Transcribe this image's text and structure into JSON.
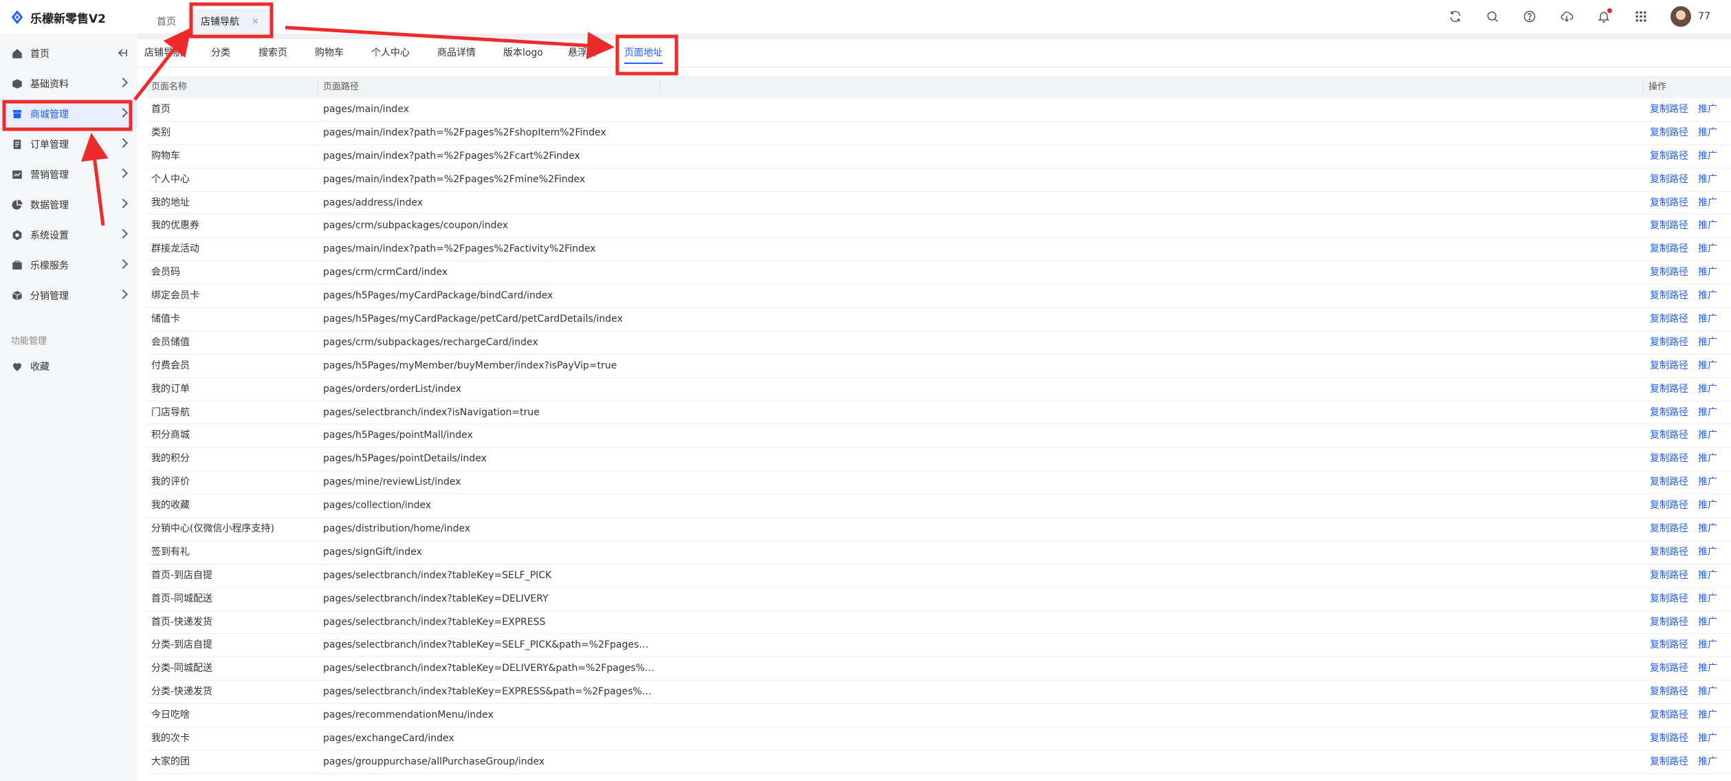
{
  "app": {
    "title": "乐檬新零售V2"
  },
  "top_tabs": [
    {
      "label": "首页"
    },
    {
      "label": "店铺导航",
      "close": "×"
    }
  ],
  "user": {
    "name": "77"
  },
  "icons": [
    "refresh-icon",
    "search-icon",
    "help-icon",
    "cloud-download-icon",
    "bell-icon",
    "apps-grid-icon"
  ],
  "colors": {
    "accent": "#1f5eff",
    "annotation": "#ee2b2b",
    "active_bg": "#e6eeff"
  },
  "sidebar": {
    "items": [
      {
        "label": "首页",
        "icon": "home-icon"
      },
      {
        "label": "基础资料",
        "icon": "box-icon"
      },
      {
        "label": "商城管理",
        "icon": "shop-icon",
        "active": true
      },
      {
        "label": "订单管理",
        "icon": "order-icon"
      },
      {
        "label": "营销管理",
        "icon": "marketing-icon"
      },
      {
        "label": "数据管理",
        "icon": "pie-chart-icon"
      },
      {
        "label": "系统设置",
        "icon": "settings-icon"
      },
      {
        "label": "乐檬服务",
        "icon": "service-icon"
      },
      {
        "label": "分销管理",
        "icon": "distribution-icon"
      }
    ],
    "section_title": "功能管理",
    "favorites_label": "收藏"
  },
  "subtabs": [
    {
      "label": "店铺导航"
    },
    {
      "label": "分类"
    },
    {
      "label": "搜索页"
    },
    {
      "label": "购物车"
    },
    {
      "label": "个人中心"
    },
    {
      "label": "商品详情"
    },
    {
      "label": "版本logo"
    },
    {
      "label": "悬浮窗"
    },
    {
      "label": "页面地址",
      "active": true
    }
  ],
  "table": {
    "headers": [
      "页面名称",
      "页面路径",
      "操作"
    ],
    "actions": [
      "复制路径",
      "推广"
    ],
    "rows": [
      {
        "name": "首页",
        "path": "pages/main/index"
      },
      {
        "name": "类别",
        "path": "pages/main/index?path=%2Fpages%2FshopItem%2Findex"
      },
      {
        "name": "购物车",
        "path": "pages/main/index?path=%2Fpages%2Fcart%2Findex"
      },
      {
        "name": "个人中心",
        "path": "pages/main/index?path=%2Fpages%2Fmine%2Findex"
      },
      {
        "name": "我的地址",
        "path": "pages/address/index"
      },
      {
        "name": "我的优惠券",
        "path": "pages/crm/subpackages/coupon/index"
      },
      {
        "name": "群接龙活动",
        "path": "pages/main/index?path=%2Fpages%2Factivity%2Findex"
      },
      {
        "name": "会员码",
        "path": "pages/crm/crmCard/index"
      },
      {
        "name": "绑定会员卡",
        "path": "pages/h5Pages/myCardPackage/bindCard/index"
      },
      {
        "name": "储值卡",
        "path": "pages/h5Pages/myCardPackage/petCard/petCardDetails/index"
      },
      {
        "name": "会员储值",
        "path": "pages/crm/subpackages/rechargeCard/index"
      },
      {
        "name": "付费会员",
        "path": "pages/h5Pages/myMember/buyMember/index?isPayVip=true"
      },
      {
        "name": "我的订单",
        "path": "pages/orders/orderList/index"
      },
      {
        "name": "门店导航",
        "path": "pages/selectbranch/index?isNavigation=true"
      },
      {
        "name": "积分商城",
        "path": "pages/h5Pages/pointMall/index"
      },
      {
        "name": "我的积分",
        "path": "pages/h5Pages/pointDetails/index"
      },
      {
        "name": "我的评价",
        "path": "pages/mine/reviewList/index"
      },
      {
        "name": "我的收藏",
        "path": "pages/collection/index"
      },
      {
        "name": "分销中心(仅微信小程序支持)",
        "path": "pages/distribution/home/index"
      },
      {
        "name": "签到有礼",
        "path": "pages/signGift/index"
      },
      {
        "name": "首页-到店自提",
        "path": "pages/selectbranch/index?tableKey=SELF_PICK"
      },
      {
        "name": "首页-同城配送",
        "path": "pages/selectbranch/index?tableKey=DELIVERY"
      },
      {
        "name": "首页-快递发货",
        "path": "pages/selectbranch/index?tableKey=EXPRESS"
      },
      {
        "name": "分类-到店自提",
        "path": "pages/selectbranch/index?tableKey=SELF_PICK&path=%2Fpages%2F..."
      },
      {
        "name": "分类-同城配送",
        "path": "pages/selectbranch/index?tableKey=DELIVERY&path=%2Fpages%2F..."
      },
      {
        "name": "分类-快递发货",
        "path": "pages/selectbranch/index?tableKey=EXPRESS&path=%2Fpages%2Fm..."
      },
      {
        "name": "今日吃啥",
        "path": "pages/recommendationMenu/index"
      },
      {
        "name": "我的次卡",
        "path": "pages/exchangeCard/index"
      },
      {
        "name": "大家的团",
        "path": "pages/grouppurchase/allPurchaseGroup/index"
      }
    ]
  }
}
